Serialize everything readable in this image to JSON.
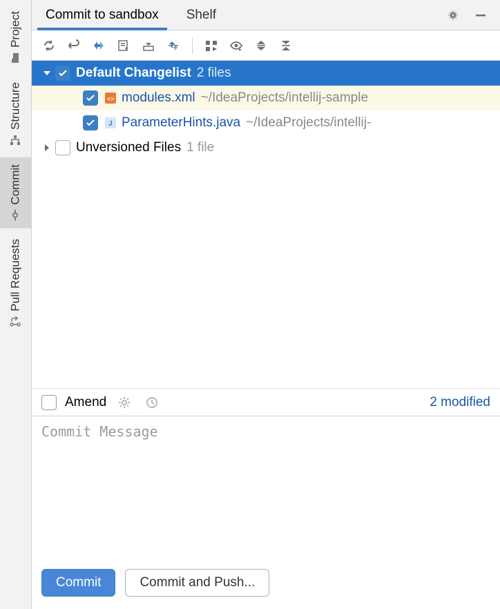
{
  "sidebar": {
    "items": [
      {
        "label": "Project",
        "icon": "folder-icon",
        "active": false
      },
      {
        "label": "Structure",
        "icon": "structure-icon",
        "active": false
      },
      {
        "label": "Commit",
        "icon": "commit-icon",
        "active": true
      },
      {
        "label": "Pull Requests",
        "icon": "pull-request-icon",
        "active": false
      }
    ]
  },
  "tabs": {
    "items": [
      {
        "label": "Commit to sandbox",
        "active": true
      },
      {
        "label": "Shelf",
        "active": false
      }
    ]
  },
  "tree": {
    "changelist": {
      "name": "Default Changelist",
      "count_label": "2 files",
      "files": [
        {
          "name": "modules.xml",
          "path": "~/IdeaProjects/intellij-sample",
          "icon": "xml",
          "highlight": true
        },
        {
          "name": "ParameterHints.java",
          "path": "~/IdeaProjects/intellij-",
          "icon": "java",
          "highlight": false
        }
      ]
    },
    "unversioned": {
      "name": "Unversioned Files",
      "count_label": "1 file"
    }
  },
  "amend": {
    "label": "Amend",
    "status_link": "2 modified"
  },
  "commit_message": {
    "placeholder": "Commit Message",
    "value": ""
  },
  "buttons": {
    "commit": "Commit",
    "commit_push": "Commit and Push..."
  }
}
